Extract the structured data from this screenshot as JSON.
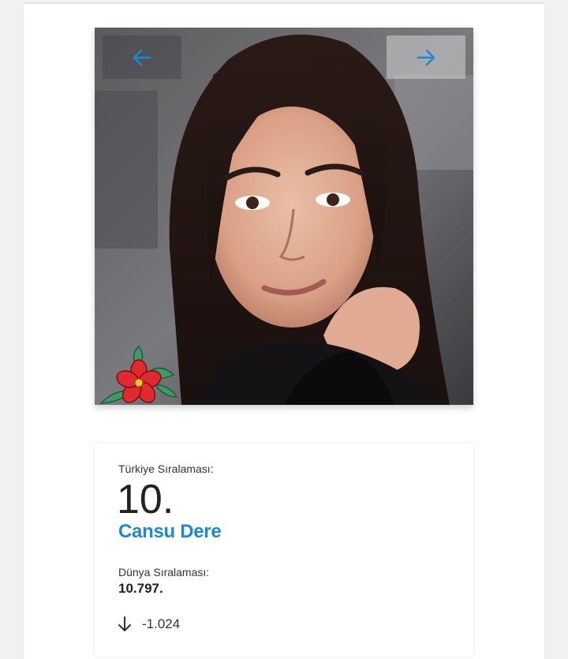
{
  "carousel": {
    "prev_icon": "arrow-left-icon",
    "next_icon": "arrow-right-icon",
    "badge_icon": "red-flower-icon",
    "accent_color": "#1e88d4"
  },
  "ranking": {
    "turkey_label": "Türkiye Sıralaması:",
    "turkey_rank": "10.",
    "name": "Cansu Dere",
    "world_label": "Dünya Sıralaması:",
    "world_rank": "10.797.",
    "change_icon": "arrow-down-icon",
    "change_value": "-1.024"
  }
}
